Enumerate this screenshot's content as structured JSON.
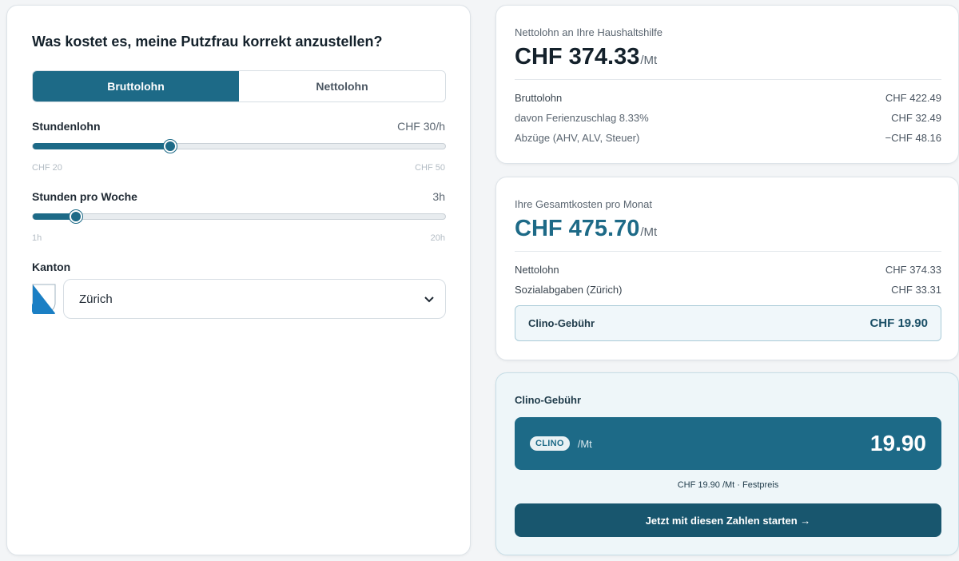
{
  "calculator": {
    "title": "Was kostet es, meine Putzfrau korrekt anzustellen?",
    "tabs": {
      "gross": "Bruttolohn",
      "net": "Nettolohn",
      "active": "gross"
    },
    "hourly_wage": {
      "label": "Stundenlohn",
      "value_text": "CHF 30/h",
      "min_label": "CHF 20",
      "max_label": "CHF 50",
      "value": 30,
      "min": 20,
      "max": 50
    },
    "hours_per_week": {
      "label": "Stunden pro Woche",
      "value_text": "3h",
      "min_label": "1h",
      "max_label": "20h",
      "value": 3,
      "min": 1,
      "max": 20
    },
    "canton": {
      "label": "Kanton",
      "selected": "Zürich",
      "crest_icon": "zurich-crest-icon"
    }
  },
  "net_summary": {
    "subtitle": "Nettolohn an Ihre Haushaltshilfe",
    "amount": "CHF 374.33",
    "unit": "/Mt",
    "rows": [
      {
        "label": "Bruttolohn",
        "value": "CHF 422.49"
      },
      {
        "label": "davon Ferienzuschlag 8.33%",
        "value": "CHF 32.49"
      },
      {
        "label": "Abzüge (AHV, ALV, Steuer)",
        "value": "−CHF 48.16"
      }
    ]
  },
  "total_summary": {
    "subtitle": "Ihre Gesamtkosten pro Monat",
    "amount": "CHF 475.70",
    "unit": "/Mt",
    "rows": [
      {
        "label": "Nettolohn",
        "value": "CHF 374.33"
      },
      {
        "label": "Sozialabgaben (Zürich)",
        "value": "CHF 33.31"
      }
    ],
    "fee": {
      "label": "Clino-Gebühr",
      "value": "CHF 19.90"
    }
  },
  "fee_card": {
    "title": "Clino-Gebühr",
    "badge": "CLINO",
    "per": "/Mt",
    "amount": "19.90",
    "note": "CHF 19.90 /Mt · Festpreis",
    "cta": "Jetzt mit diesen Zahlen starten →"
  },
  "colors": {
    "accent": "#1d6a87",
    "accent_dark": "#18566e",
    "total_amount": "#1d6a87"
  }
}
